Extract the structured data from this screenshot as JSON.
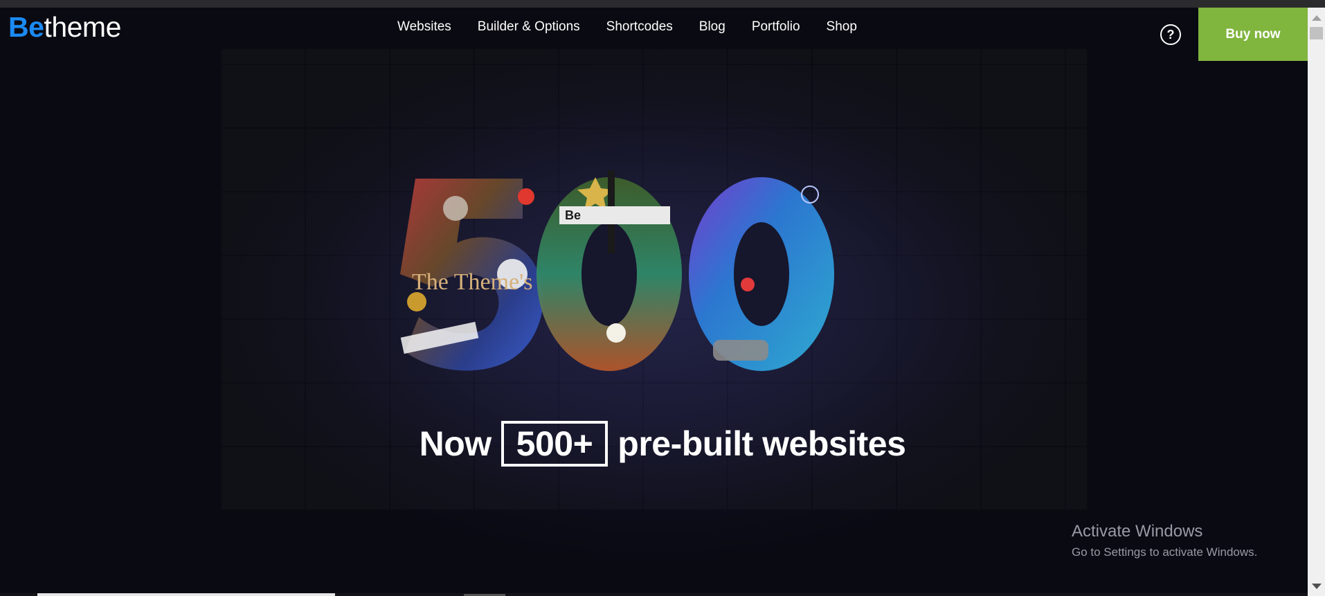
{
  "logo": {
    "be": "Be",
    "rest": "theme"
  },
  "nav": {
    "items": [
      {
        "label": "Websites"
      },
      {
        "label": "Builder & Options"
      },
      {
        "label": "Shortcodes"
      },
      {
        "label": "Blog"
      },
      {
        "label": "Portfolio"
      },
      {
        "label": "Shop"
      }
    ]
  },
  "header": {
    "help_icon": "question-circle-icon",
    "help_glyph": "?",
    "buy_label": "Buy now"
  },
  "hero": {
    "graphic_number": "500",
    "graphic_badge": "Be",
    "graphic_caption": "The Theme's",
    "headline_before": "Now",
    "headline_boxed": "500+",
    "headline_after": "pre-built websites"
  },
  "watermark": {
    "title": "Activate Windows",
    "subtitle": "Go to Settings to activate Windows."
  },
  "colors": {
    "brand_blue": "#1b8af3",
    "buy_green": "#80b53e",
    "background": "#0b0b14",
    "watermark": "#9a9aa6"
  }
}
